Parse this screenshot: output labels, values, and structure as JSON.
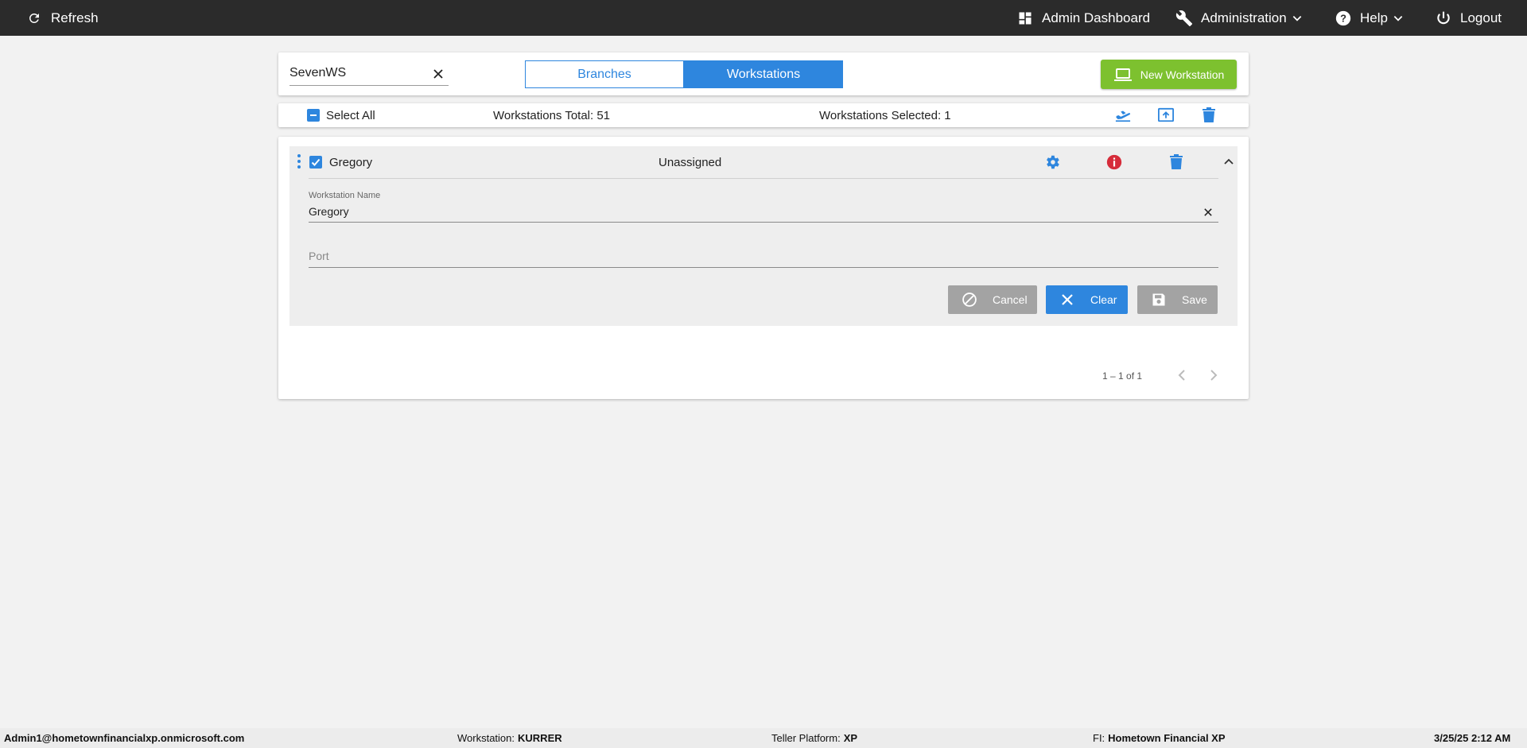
{
  "topbar": {
    "refresh_label": "Refresh",
    "admin_dashboard_label": "Admin Dashboard",
    "administration_label": "Administration",
    "help_label": "Help",
    "logout_label": "Logout"
  },
  "toolbar": {
    "search_value": "SevenWS",
    "tabs": [
      "Branches",
      "Workstations"
    ],
    "active_tab": "Workstations",
    "new_button_label": "New Workstation"
  },
  "selection_bar": {
    "select_all_label": "Select All",
    "total_label": "Workstations Total: 51",
    "selected_label": "Workstations Selected: 1"
  },
  "row": {
    "name": "Gregory",
    "status": "Unassigned",
    "checked": true,
    "form": {
      "workstation_name_label": "Workstation Name",
      "workstation_name_value": "Gregory",
      "port_placeholder": "Port",
      "port_value": ""
    },
    "buttons": {
      "cancel": "Cancel",
      "clear": "Clear",
      "save": "Save"
    }
  },
  "pager": {
    "range_text": "1 – 1 of 1"
  },
  "footer": {
    "user": "Admin1@hometownfinancialxp.onmicrosoft.com",
    "workstation_label": "Workstation:",
    "workstation_value": "KURRER",
    "platform_label": "Teller Platform:",
    "platform_value": "XP",
    "fi_label": "FI:",
    "fi_value": "Hometown Financial XP",
    "datetime": "3/25/25 2:12 AM"
  },
  "colors": {
    "primary": "#2e86de",
    "success": "#7dc12f",
    "danger": "#d62c3a",
    "topbar": "#2b2b2b"
  },
  "icons": [
    "refresh-icon",
    "dashboard-icon",
    "wrench-icon",
    "help-icon",
    "power-icon",
    "laptop-icon",
    "airplane-icon",
    "upload-icon",
    "trash-icon",
    "gear-icon",
    "info-icon",
    "chevron-up-icon",
    "ban-icon",
    "close-icon",
    "save-icon",
    "chevron-left-icon",
    "chevron-right-icon"
  ]
}
